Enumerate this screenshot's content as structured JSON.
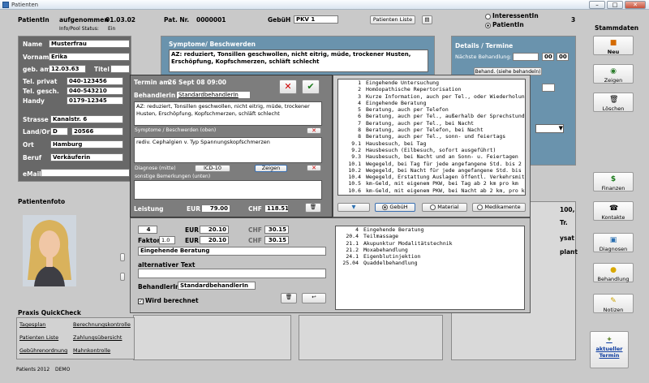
{
  "window": {
    "title": "Patienten"
  },
  "header": {
    "patient_label": "PatientIn",
    "status": "aufgenommen",
    "date": "01.03.02",
    "info_label": "Info/Pool Status:",
    "info_value": "Ein",
    "patnr_label": "Pat. Nr.",
    "patnr_value": "0000001",
    "gebuehr_label": "GebüH",
    "gebuehr_value": "PKV 1",
    "patients_list_button": "Patienten Liste",
    "radio_interessent": "InteressentIn",
    "radio_patient": "PatientIn",
    "count": "3"
  },
  "person": {
    "name_label": "Name",
    "name": "Musterfrau",
    "vorname_label": "Vorname",
    "vorname": "Erika",
    "geb_label": "geb. am",
    "geb": "12.03.63",
    "titel_label": "Titel",
    "tel_privat_label": "Tel. privat",
    "tel_privat": "040-123456",
    "tel_gesch_label": "Tel. gesch.",
    "tel_gesch": "040-543210",
    "handy_label": "Handy",
    "handy": "0179-12345",
    "strasse_label": "Strasse",
    "strasse": "Kanalstr. 6",
    "landort_label": "Land/Ort",
    "land": "D",
    "plz": "20566",
    "ort_label": "Ort",
    "ort": "Hamburg",
    "beruf_label": "Beruf",
    "beruf": "Verkäuferin",
    "email_label": "eMail"
  },
  "photo_label": "Patientenfoto",
  "symptoms": {
    "title": "Symptome/ Beschwerden",
    "text": "AZ: reduziert, Tonsillen geschwollen, nicht eitrig, müde, trockener Husten, Erschöpfung, Kopfschmerzen, schläft schlecht"
  },
  "details": {
    "title": "Details / Termine",
    "next_label": "Nächste Behandlung:",
    "hh": "00",
    "mm": "00",
    "link_btn": "Behand. (siehe behandeln)"
  },
  "dialog": {
    "termin_label": "Termin am:",
    "termin_value": "26 Sept 08  09:00",
    "behandler_label": "Behandlerin:",
    "behandler_value": "StandardbehandlerIn",
    "symptom_text": "AZ: reduziert, Tonsillen geschwollen, nicht eitrig, müde, trockener Husten, Erschöpfung, Kopfschmerzen, schläft schlecht",
    "symptom_caption": "Symptome / Beschwerden (oben)",
    "diagnose_text": "rediv. Cephalgien v. Typ Spannungskopfschmerzen",
    "diagnose_caption": "Diagnose (mitte)",
    "icd_button": "ICD-10",
    "zeigen_button": "Zeigen",
    "bemerkungen_caption": "sonstige Bemerkungen (unten)",
    "leistung_label": "Leistung",
    "eur_label": "EUR",
    "eur_value": "79.00",
    "chf_label": "CHF",
    "chf_value": "118.51",
    "codes": [
      {
        "c": "1",
        "t": "Eingehende Untersuchung"
      },
      {
        "c": "2",
        "t": "Homöopathische Repertorisation"
      },
      {
        "c": "3",
        "t": "Kurze Information, auch per Tel., oder Wiederholun"
      },
      {
        "c": "4",
        "t": "Eingehende Beratung"
      },
      {
        "c": "5",
        "t": "Beratung, auch per Telefon"
      },
      {
        "c": "6",
        "t": "Beratung, auch per Tel., außerhalb der Sprechstund"
      },
      {
        "c": "7",
        "t": "Beratung, auch per Tel., bei Nacht"
      },
      {
        "c": "8",
        "t": "Beratung, auch per Telefon, bei Nacht"
      },
      {
        "c": "8",
        "t": "Beratung, auch per Tel., sonn- und feiertags"
      },
      {
        "c": "9.1",
        "t": "Hausbesuch, bei Tag"
      },
      {
        "c": "9.2",
        "t": "Hausbesuch (Eilbesuch, sofort ausgeführt)"
      },
      {
        "c": "9.3",
        "t": "Hausbesuch, bei Nacht und an Sonn- u. Feiertagen"
      },
      {
        "c": "10.1",
        "t": "Wegegeld, bei Tag für jede angefangene Std. bis 2"
      },
      {
        "c": "10.2",
        "t": "Wegegeld, bei Nacht für jede angefangene Std. bis"
      },
      {
        "c": "10.4",
        "t": "Wegegeld, Erstattung Auslagen öffentl. Verkehrsmit"
      },
      {
        "c": "10.5",
        "t": "km-Geld, mit eigenem PKW, bei Tag ab 2 km pro km"
      },
      {
        "c": "10.6",
        "t": "km-Geld, mit eigenem PKW, bei Nacht ab 2 km, pro k"
      }
    ],
    "radio_gebueh": "GebüH",
    "radio_material": "Material",
    "radio_medikamente": "Medikamente",
    "qty": "4",
    "item_eur": "20.10",
    "item_chf": "30.15",
    "faktor_label": "Faktor",
    "faktor": "1.0",
    "faktor_eur": "20.10",
    "faktor_chf": "30.15",
    "item_text": "Eingehende Beratung",
    "alt_label": "alternativer Text",
    "item_behandler_label": "BehandlerIn:",
    "item_behandler_value": "StandardbehandlerIn",
    "wird_label": "Wird berechnet",
    "selected": [
      {
        "c": "4",
        "t": "Eingehende Beratung"
      },
      {
        "c": "20.4",
        "t": "Teilmassage"
      },
      {
        "c": "21.1",
        "t": "Akupunktur Modalitätstechnik"
      },
      {
        "c": "21.2",
        "t": "Moxabehandlung"
      },
      {
        "c": "24.1",
        "t": "Eigenblutinjektion"
      },
      {
        "c": "25.04",
        "t": "Quaddelbehandlung"
      }
    ]
  },
  "bg_fragments": {
    "a": "100,",
    "b": "Tr.",
    "c": "ysat",
    "d": "plant"
  },
  "quickcheck": {
    "title": "Praxis QuickCheck",
    "links": [
      "Tagesplan",
      "Berechnungskontrolle",
      "Patienten Liste",
      "Zahlungsübersicht",
      "Gebührenordnung",
      "Mahnkontrolle"
    ]
  },
  "footer": {
    "text": "Patients 2012",
    "demo": "DEMO"
  },
  "sidebar": {
    "title": "Stammdaten",
    "buttons": [
      "Neu",
      "Zeigen",
      "Löschen",
      "Finanzen",
      "Kontakte",
      "Diagnosen",
      "Behandlung",
      "Notizen"
    ],
    "termin_button": "aktueller Termin"
  }
}
